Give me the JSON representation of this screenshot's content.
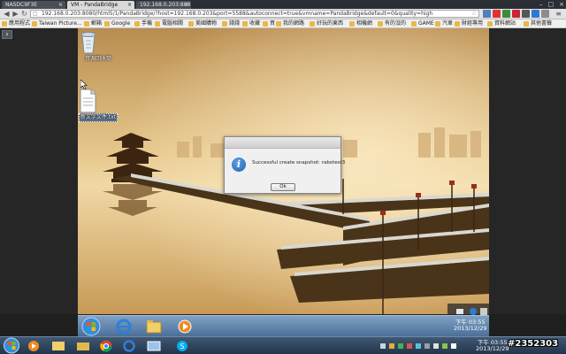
{
  "browser": {
    "tabs": [
      {
        "label": "NASDC9F3E",
        "active": false
      },
      {
        "label": "VM - PandaBridge",
        "active": true
      },
      {
        "label": "192.168.0.203:808",
        "active": false
      }
    ],
    "url": "192.168.0.203:8080/html5/1/PandaBridge/?host=192.168.0.203&port=5588&autoconnect=true&vmname=PandaBridge&default=0&quality=high",
    "bookmarks": [
      "應用程式",
      "Taiwan Picture...",
      "郵箱",
      "Google",
      "手機",
      "電腦相關",
      "美國購物",
      "錢錢",
      "收藏",
      "買",
      "我的網路",
      "好玩的東西",
      "相機網",
      "有的沒的",
      "GAME",
      "汽車",
      "財經專用",
      "資料網站",
      "其他書籤"
    ]
  },
  "remote_desktop": {
    "icons": [
      {
        "label": "資源回收筒",
        "type": "recycle-bin"
      },
      {
        "label": "新文字文件.txt",
        "type": "text-file",
        "selected": true
      }
    ],
    "dialog": {
      "message": "Successful create snapshot: rabotest3",
      "ok_label": "Ok"
    },
    "clock": {
      "time": "下午 03:55",
      "date": "2013/12/29"
    }
  },
  "host_taskbar": {
    "clock": {
      "time": "下午 03:55",
      "date": "2013/12/29"
    }
  },
  "watermark": "#2352303",
  "colors": {
    "accent": "#1d5fad",
    "taskbar": "#3f5873"
  }
}
